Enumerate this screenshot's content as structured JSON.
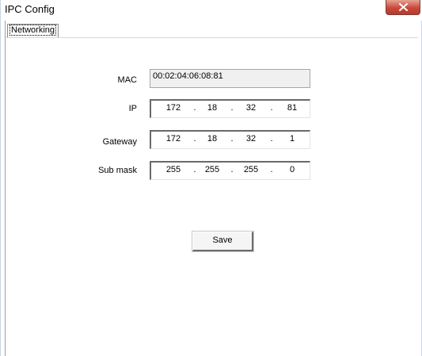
{
  "window": {
    "title": "IPC Config"
  },
  "tabs": [
    {
      "label": "Networking"
    }
  ],
  "form": {
    "mac": {
      "label": "MAC",
      "value": "00:02:04:06:08:81"
    },
    "ip": {
      "label": "IP",
      "octets": [
        "172",
        "18",
        "32",
        "81"
      ]
    },
    "gateway": {
      "label": "Gateway",
      "octets": [
        "172",
        "18",
        "32",
        "1"
      ]
    },
    "submask": {
      "label": "Sub mask",
      "octets": [
        "255",
        "255",
        "255",
        "0"
      ]
    },
    "separator": "."
  },
  "buttons": {
    "save_label": "Save"
  },
  "colors": {
    "close_button": "#c9493b",
    "field_border_dark": "#696969",
    "readonly_field_bg": "#f0f0f0"
  },
  "icons": {
    "close": "close-icon"
  }
}
